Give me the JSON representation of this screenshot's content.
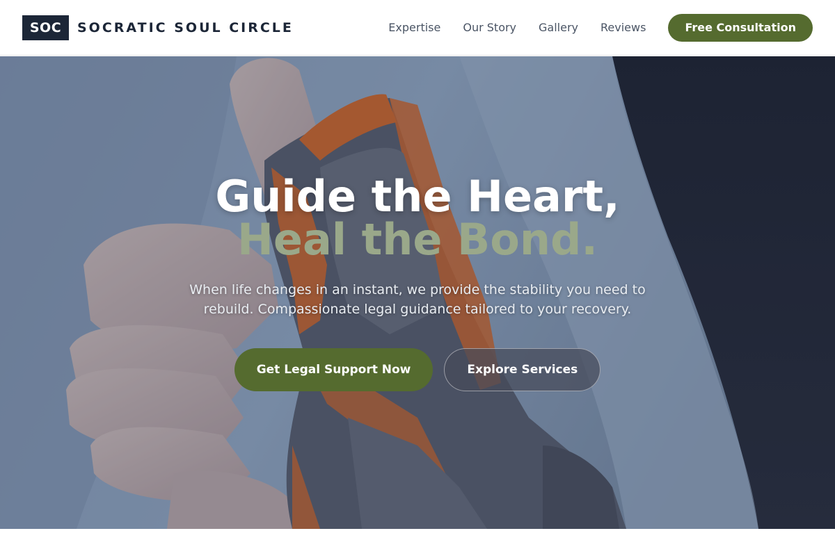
{
  "brand": {
    "logo_text": "SOC",
    "name": "SOCRATIC SOUL CIRCLE"
  },
  "nav": {
    "links": [
      "Expertise",
      "Our Story",
      "Gallery",
      "Reviews"
    ],
    "cta_label": "Free Consultation"
  },
  "hero": {
    "title_line1": "Guide the Heart,",
    "title_line2": "Heal the Bond.",
    "subtitle": "When life changes in an instant, we provide the stability you need to rebuild. Compassionate legal guidance tailored to your recovery.",
    "primary_button": "Get Legal Support Now",
    "secondary_button": "Explore Services",
    "image_description_icon": "hand-brace-photo"
  },
  "colors": {
    "brand_dark": "#1c2637",
    "accent_olive": "#556b2f",
    "accent_sage": "#9aa88a"
  }
}
